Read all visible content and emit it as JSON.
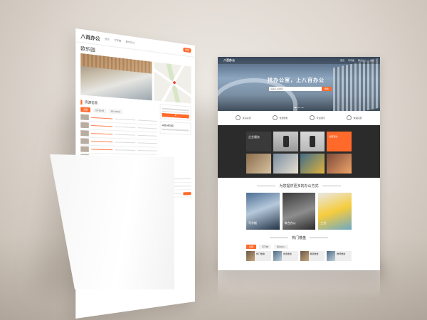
{
  "left_page": {
    "logo": "八百办公",
    "nav": [
      "首页",
      "写字楼",
      "联合办公",
      "资讯"
    ],
    "nav_active": "登录",
    "title": "欧乐园",
    "section_houses": "房源信息",
    "tabs": [
      "全部",
      "20-50㎡",
      "50-100㎡"
    ],
    "section_rent": "出租房源",
    "phone": "400-6060",
    "news_caption": "写字楼资讯"
  },
  "right_page": {
    "logo": "八百办公",
    "nav": [
      "首页",
      "写字楼",
      "联合办公",
      "资讯"
    ],
    "slogan": "找办公室，上八百办公",
    "search": {
      "placeholder": "请输入关键词",
      "button": "搜索"
    },
    "features": [
      "真实房源",
      "免费服务",
      "专业顾问",
      "快速匹配"
    ],
    "enterprise_label": "企业服务",
    "promo_label": "优惠活动",
    "ways_heading": "为您提供更多的办公方式",
    "ways": [
      "写字楼",
      "联合办公",
      "工位"
    ],
    "hot_heading": "热门楼盘",
    "hot_tabs": [
      "全部",
      "写字楼",
      "联合办公"
    ],
    "hot_items": [
      "热门楼盘",
      "优选楼盘",
      "精选楼盘",
      "推荐楼盘"
    ]
  },
  "colors": {
    "accent": "#ff6a2b",
    "dark_band": "#2b2b2b"
  }
}
